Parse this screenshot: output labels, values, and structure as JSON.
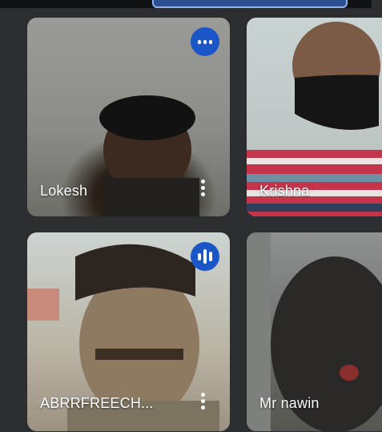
{
  "participants": [
    {
      "name": "Lokesh",
      "speaking": false,
      "has_menu": true
    },
    {
      "name": "Krishna",
      "speaking": false,
      "has_menu": false
    },
    {
      "name": "ABRRFREECH...",
      "speaking": true,
      "has_menu": true
    },
    {
      "name": "Mr nawin",
      "speaking": false,
      "has_menu": false
    }
  ],
  "icons": {
    "audio_indicator": "audio-level-icon",
    "more_options": "more-vert-icon"
  },
  "colors": {
    "background": "#2c2d31",
    "audio_badge": "#1a56c7",
    "name_text": "#ffffff"
  }
}
